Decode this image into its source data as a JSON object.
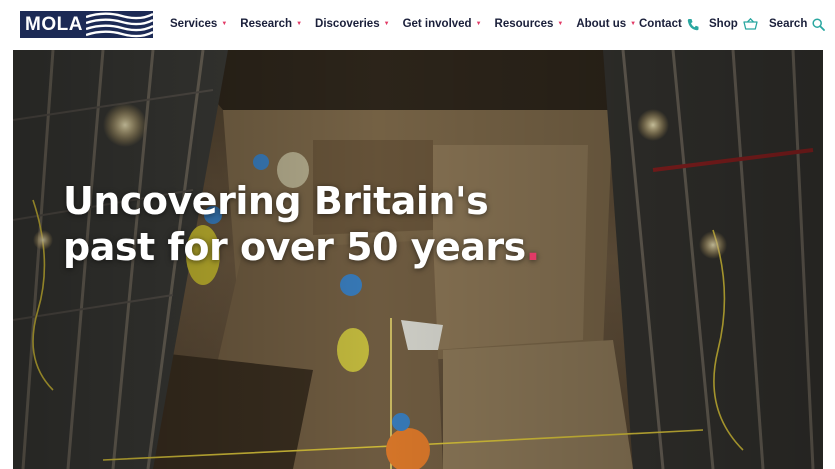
{
  "brand": {
    "name": "MOLA",
    "color": "#1c2a55"
  },
  "nav": [
    {
      "label": "Services"
    },
    {
      "label": "Research"
    },
    {
      "label": "Discoveries"
    },
    {
      "label": "Get involved"
    },
    {
      "label": "Resources"
    },
    {
      "label": "About us"
    }
  ],
  "utility": {
    "contact": {
      "label": "Contact",
      "icon": "phone-icon"
    },
    "shop": {
      "label": "Shop",
      "icon": "basket-icon"
    },
    "search": {
      "label": "Search",
      "icon": "search-icon"
    }
  },
  "hero": {
    "headline_line1": "Uncovering Britain's",
    "headline_line2": "past for over 50 years",
    "headline_punct": ".",
    "image": "archaeological-excavation-photo"
  },
  "colors": {
    "accent": "#e23a66",
    "icon_teal": "#2aa7a0",
    "text_dark": "#1a1f3a"
  }
}
